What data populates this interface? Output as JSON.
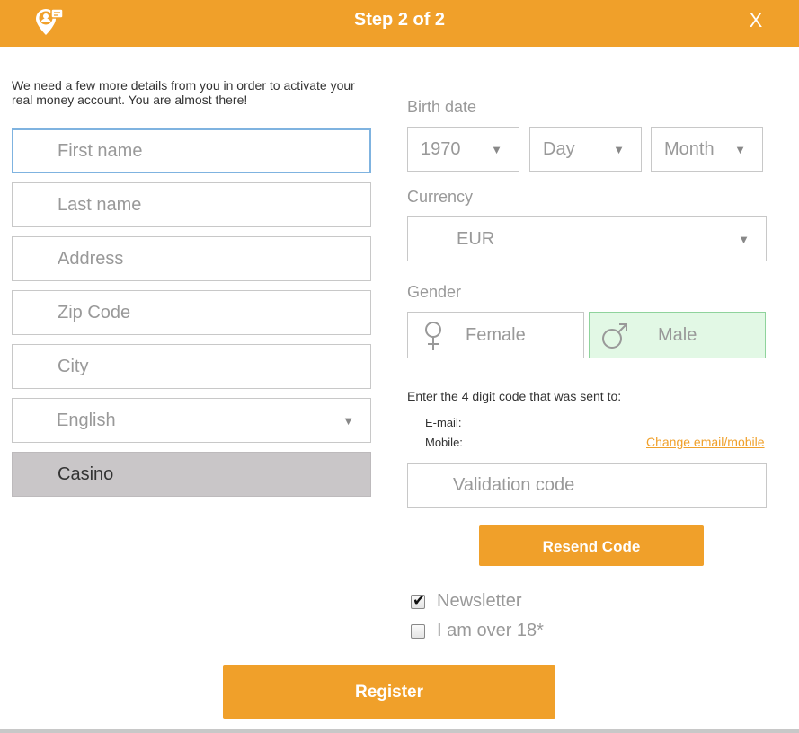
{
  "header": {
    "title": "Step 2 of 2",
    "close_label": "X",
    "logo_icon": "location-pin-chat-icon",
    "background": "#f0a02a"
  },
  "intro_text": "We need a few more details from you in order to activate your real money account. You are almost there!",
  "form": {
    "first_name": {
      "placeholder": "First name",
      "value": ""
    },
    "last_name": {
      "placeholder": "Last name",
      "value": ""
    },
    "address": {
      "placeholder": "Address",
      "value": ""
    },
    "zip_code": {
      "placeholder": "Zip Code",
      "value": ""
    },
    "city": {
      "placeholder": "City",
      "value": ""
    },
    "language": {
      "selected": "English",
      "icon": "chevron-down-icon"
    },
    "product": {
      "selected": "Casino"
    }
  },
  "birth_date": {
    "label": "Birth date",
    "year": "1970",
    "day": "Day",
    "month": "Month"
  },
  "currency": {
    "label": "Currency",
    "selected": "EUR"
  },
  "gender": {
    "label": "Gender",
    "female": "Female",
    "male": "Male",
    "selected": "male",
    "selected_color": "#e2f8e5"
  },
  "verification": {
    "instruction": "Enter the 4 digit code that was sent to:",
    "email_label": "E-mail:",
    "email_value": "",
    "mobile_label": "Mobile:",
    "mobile_value": "",
    "change_link": "Change email/mobile",
    "code_placeholder": "Validation code",
    "resend_label": "Resend Code"
  },
  "options": {
    "newsletter_label": "Newsletter",
    "newsletter_checked": true,
    "age_label": "I am over 18*",
    "age_checked": false
  },
  "register_label": "Register",
  "accent_color": "#f0a02a"
}
